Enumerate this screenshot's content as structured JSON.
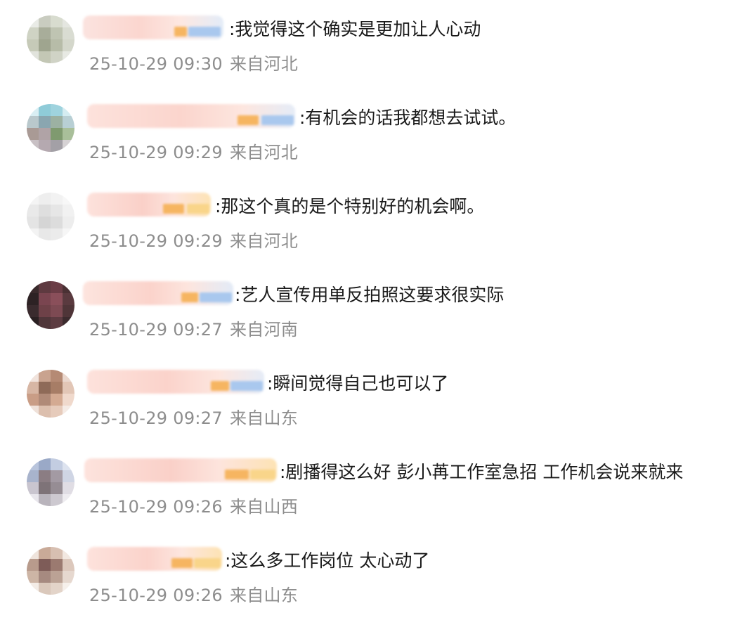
{
  "comments": [
    {
      "text": ":我觉得这个确实是更加让人心动",
      "time": "25-10-29 09:30",
      "location": "来自河北",
      "avatar_colors": [
        "#e9ebe6",
        "#c9ccc0",
        "#d8dccf",
        "#e4e6e0",
        "#cfd3c4",
        "#a8ad9a",
        "#bfc4b2",
        "#d9dcd2",
        "#c6cab8",
        "#9fa58f",
        "#b7bca8",
        "#d4d7cb",
        "#e1e3dc",
        "#c3c7b5",
        "#d0d3c6",
        "#e7e9e3"
      ]
    },
    {
      "text": ":有机会的话我都想去试试。",
      "time": "25-10-29 09:29",
      "location": "来自河北",
      "avatar_colors": [
        "#d9eef3",
        "#8fcbd8",
        "#9fd3de",
        "#d4ecf1",
        "#b9c8cc",
        "#8aa6b0",
        "#9cb1a2",
        "#b8cfd4",
        "#a99a95",
        "#b0a3a6",
        "#7f9a6f",
        "#a9bf9a",
        "#c8c0c4",
        "#b5a9b0",
        "#a3a0a6",
        "#d6d2d4"
      ]
    },
    {
      "text": ":那这个真的是个特别好的机会啊。",
      "time": "25-10-29 09:29",
      "location": "来自河北",
      "avatar_colors": [
        "#f4f4f4",
        "#eeeeee",
        "#f2f2f2",
        "#f7f7f7",
        "#e9e9e9",
        "#dedede",
        "#e6e6e6",
        "#f1f1f1",
        "#e4e4e4",
        "#d5d5d5",
        "#dcdcdc",
        "#ededed",
        "#f3f3f3",
        "#e8e8e8",
        "#ebebeb",
        "#f6f6f6"
      ]
    },
    {
      "text": ":艺人宣传用单反拍照这要求很实际",
      "time": "25-10-29 09:27",
      "location": "来自河南",
      "avatar_colors": [
        "#3a2a2c",
        "#5e3a40",
        "#6b3d46",
        "#4a3134",
        "#2d2224",
        "#7a4550",
        "#8a4f5a",
        "#5a3a3f",
        "#3a2b2e",
        "#6e4148",
        "#7d4a53",
        "#4f3538",
        "#2a2022",
        "#50363a",
        "#5c3b41",
        "#3c2b2e"
      ]
    },
    {
      "text": ":瞬间觉得自己也可以了",
      "time": "25-10-29 09:27",
      "location": "来自山东",
      "avatar_colors": [
        "#f1e3dc",
        "#c9a38f",
        "#b58a74",
        "#ead7cd",
        "#d7b6a4",
        "#8e6a58",
        "#a77d66",
        "#e2c6b6",
        "#c99d86",
        "#b08a78",
        "#d4aa92",
        "#f0d9cc",
        "#efe1d9",
        "#dcbfae",
        "#e6cbbb",
        "#f5ebe5"
      ]
    },
    {
      "text": ":剧播得这么好 彭小苒工作室急招 工作机会说来就来",
      "time": "25-10-29 09:26",
      "location": "来自山西",
      "avatar_colors": [
        "#b8c4dc",
        "#9aa9c7",
        "#c3cde1",
        "#dde3ef",
        "#a8b3cc",
        "#8b7d83",
        "#a39aa3",
        "#cfd5e4",
        "#c9c5cf",
        "#7e7378",
        "#968d94",
        "#e0dde4",
        "#e8e6ec",
        "#b9b4bc",
        "#cdc9d0",
        "#eeecf0"
      ]
    },
    {
      "text": ":这么多工作岗位 太心动了",
      "time": "25-10-29 09:26",
      "location": "来自山东",
      "avatar_colors": [
        "#efe4dc",
        "#c9aa98",
        "#d7bfb1",
        "#f2e8e1",
        "#b89b8c",
        "#7e5c58",
        "#9b7a70",
        "#dcc8bc",
        "#cdb5a5",
        "#a68a80",
        "#bba295",
        "#e6d8cf",
        "#f3ece6",
        "#dac8bb",
        "#e3d4c9",
        "#f6f0eb"
      ]
    }
  ]
}
